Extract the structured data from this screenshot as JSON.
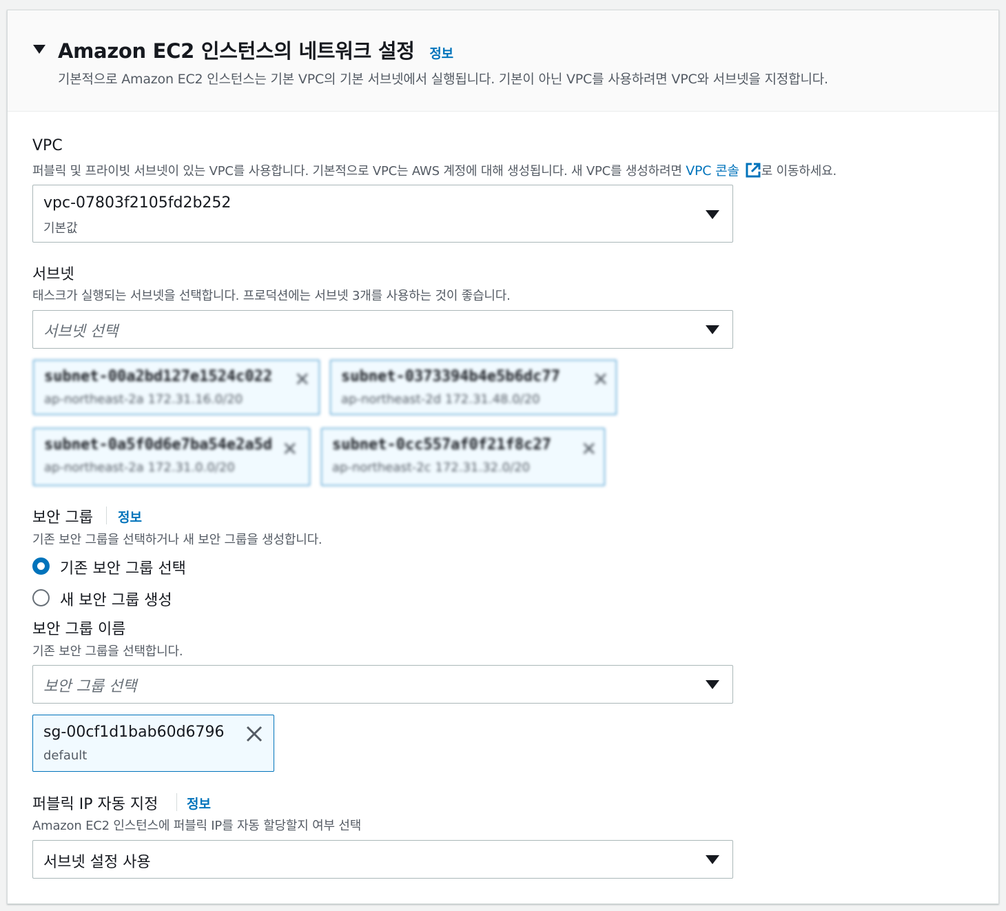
{
  "header": {
    "title": "Amazon EC2 인스턴스의 네트워크 설정",
    "info": "정보",
    "description": "기본적으로 Amazon EC2 인스턴스는 기본 VPC의 기본 서브넷에서 실행됩니다. 기본이 아닌 VPC를 사용하려면 VPC와 서브넷을 지정합니다."
  },
  "vpc": {
    "label": "VPC",
    "description_prefix": "퍼블릭 및 프라이빗 서브넷이 있는 VPC를 사용합니다. 기본적으로 VPC는 AWS 계정에 대해 생성됩니다. 새 VPC를 생성하려면 ",
    "console_link": "VPC 콘솔",
    "description_suffix": "로 이동하세요.",
    "selected_value": "vpc-07803f2105fd2b252",
    "selected_sub": "기본값"
  },
  "subnet": {
    "label": "서브넷",
    "description": "태스크가 실행되는 서브넷을 선택합니다. 프로덕션에는 서브넷 3개를 사용하는 것이 좋습니다.",
    "placeholder": "서브넷 선택",
    "tokens": [
      {
        "id": "subnet-00a2bd127e1524c022",
        "sub": "ap-northeast-2a 172.31.16.0/20"
      },
      {
        "id": "subnet-0373394b4e5b6dc77",
        "sub": "ap-northeast-2d 172.31.48.0/20"
      },
      {
        "id": "subnet-0a5f0d6e7ba54e2a5d",
        "sub": "ap-northeast-2a 172.31.0.0/20"
      },
      {
        "id": "subnet-0cc557af0f21f8c27",
        "sub": "ap-northeast-2c 172.31.32.0/20"
      }
    ]
  },
  "security_group": {
    "label": "보안 그룹",
    "info": "정보",
    "description": "기존 보안 그룹을 선택하거나 새 보안 그룹을 생성합니다.",
    "options": [
      {
        "label": "기존 보안 그룹 선택",
        "checked": true
      },
      {
        "label": "새 보안 그룹 생성",
        "checked": false
      }
    ],
    "name_label": "보안 그룹 이름",
    "name_description": "기존 보안 그룹을 선택합니다.",
    "placeholder": "보안 그룹 선택",
    "token": {
      "id": "sg-00cf1d1bab60d6796",
      "sub": "default"
    }
  },
  "public_ip": {
    "label": "퍼블릭 IP 자동 지정",
    "info": "정보",
    "description": "Amazon EC2 인스턴스에 퍼블릭 IP를 자동 할당할지 여부 선택",
    "selected_value": "서브넷 설정 사용"
  },
  "colors": {
    "link": "#0073bb",
    "token_bg": "#f1faff",
    "border": "#aab7b8"
  },
  "icons": {
    "collapse": "caret-down-icon",
    "dropdown": "caret-down-icon",
    "remove": "close-icon",
    "external": "external-link-icon"
  }
}
